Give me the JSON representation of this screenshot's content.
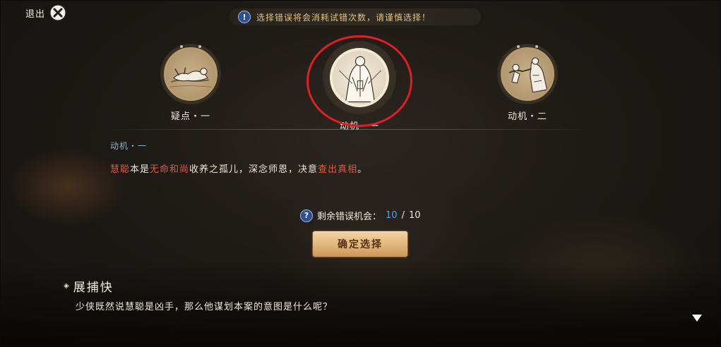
{
  "exit": {
    "label": "退出",
    "icon": "close-icon"
  },
  "warning": {
    "icon": "exclamation-icon",
    "text": "选择错误将会消耗试错次数，请谨慎选择！"
  },
  "clues": [
    {
      "label": "疑点・一",
      "icon": "fallen-body-icon"
    },
    {
      "label": "动机・一",
      "icon": "monk-figure-icon",
      "selected": true
    },
    {
      "label": "动机・二",
      "icon": "fighting-figures-icon"
    }
  ],
  "detail": {
    "title": "动机・一",
    "segments": [
      "慧聪",
      "本是",
      "无命和尚",
      "收养之孤儿，深念师恩，决意",
      "查出真相",
      "。"
    ]
  },
  "chances": {
    "label": "剩余错误机会：",
    "current": "10",
    "separator": "/",
    "total": "10"
  },
  "confirm_label": "确定选择",
  "dialog": {
    "speaker": "展捕快",
    "text": "少侠既然说慧聪是凶手，那么他谋划本案的意图是什么呢？"
  },
  "colors": {
    "highlight": "#e05a44",
    "accent_gold": "#e6c277",
    "count_blue": "#4fa0e6",
    "selection_ring": "#e01e24"
  }
}
